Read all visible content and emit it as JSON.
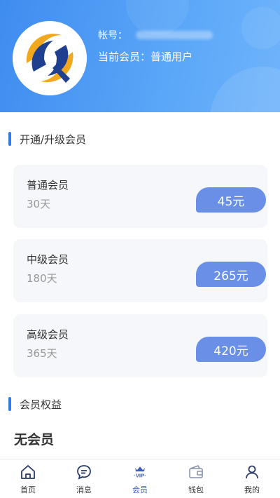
{
  "header": {
    "account_label": "帐号：",
    "member_label": "当前会员：普通用户"
  },
  "upgrade": {
    "title": "开通/升级会员",
    "plans": [
      {
        "name": "普通会员",
        "days": "30天",
        "price": "45元"
      },
      {
        "name": "中级会员",
        "days": "180天",
        "price": "265元"
      },
      {
        "name": "高级会员",
        "days": "365天",
        "price": "420元"
      }
    ]
  },
  "benefits": {
    "title": "会员权益",
    "status": "无会员"
  },
  "tabbar": {
    "items": [
      {
        "label": "首页",
        "icon": "home-icon"
      },
      {
        "label": "消息",
        "icon": "message-icon"
      },
      {
        "label": "会员",
        "icon": "vip-icon",
        "active": true
      },
      {
        "label": "钱包",
        "icon": "wallet-icon"
      },
      {
        "label": "我的",
        "icon": "user-icon"
      }
    ]
  },
  "colors": {
    "header": "#4a98f4",
    "price_pill": "#6a8fe6",
    "accent_bar": "#2f7be8",
    "active_tab": "#3a5bb8"
  }
}
